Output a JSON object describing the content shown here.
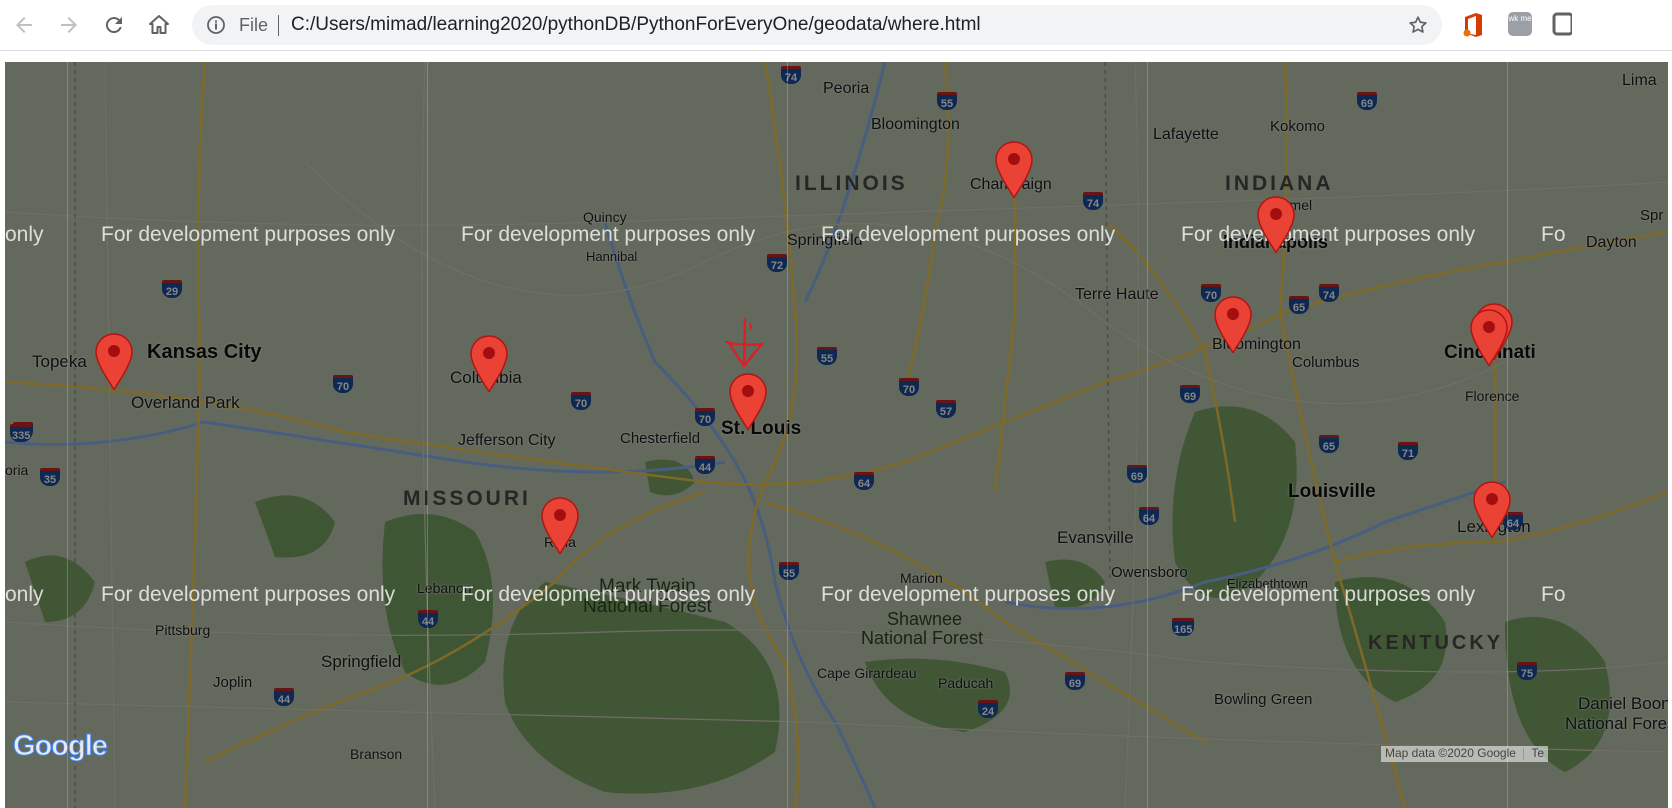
{
  "browser": {
    "back_icon": "arrow-left-icon",
    "forward_icon": "arrow-right-icon",
    "reload_icon": "reload-icon",
    "home_icon": "home-icon",
    "file_label": "File",
    "url": "C:/Users/mimad/learning2020/pythonDB/PythonForEveryOne/geodata/where.html",
    "star_icon": "star-icon",
    "extension_labels": [
      "wk me"
    ]
  },
  "map": {
    "watermark": "For development purposes only",
    "watermark_partial_left": "only",
    "watermark_partial_right": "Fo",
    "logo": "Google",
    "attribution": "Map data ©2020 Google",
    "attribution_tail": "Te",
    "cities": [
      "Peoria",
      "Bloomington",
      "Lafayette",
      "Kokomo",
      "Lima",
      "Champaign",
      "Quincy",
      "Hannibal",
      "Springfield",
      "Indianapolis",
      "Dayton",
      "Terre Haute",
      "Topeka",
      "Kansas City",
      "Overland Park",
      "Columbia",
      "Jefferson City",
      "Chesterfield",
      "St. Louis",
      "Bloomington",
      "Columbus",
      "Cincinnati",
      "Florence",
      "Louisville",
      "Evansville",
      "Owensboro",
      "Elizabethtown",
      "Lexington",
      "Rolla",
      "Lebanon",
      "Pittsburg",
      "Joplin",
      "Springfield",
      "Marion",
      "Cape Girardeau",
      "Paducah",
      "Bowling Green",
      "Branson",
      "Daniel Boone",
      "National Forest",
      "Carmel",
      "Spr",
      "oria"
    ],
    "states": [
      "ILLINOIS",
      "INDIANA",
      "MISSOURI",
      "KENTUCKY"
    ],
    "forests": [
      "Mark Twain",
      "National Forest",
      "Shawnee",
      "National Forest"
    ],
    "highways": [
      "74",
      "55",
      "69",
      "74",
      "29",
      "35",
      "72",
      "70",
      "65",
      "74",
      "335",
      "70",
      "70",
      "55",
      "70",
      "57",
      "69",
      "70",
      "44",
      "64",
      "69",
      "65",
      "71",
      "35",
      "64",
      "64",
      "44",
      "55",
      "165",
      "44",
      "69",
      "24",
      "75"
    ],
    "markers": [
      "Kansas City area",
      "Columbia",
      "Rolla",
      "St. Louis",
      "Champaign",
      "Indianapolis",
      "Bloomington",
      "Cincinnati",
      "Cincinnati",
      "Lexington"
    ]
  },
  "colors": {
    "marker": "#ea4335",
    "marker_dot": "#a50e0e",
    "annotation": "#e31b23"
  }
}
